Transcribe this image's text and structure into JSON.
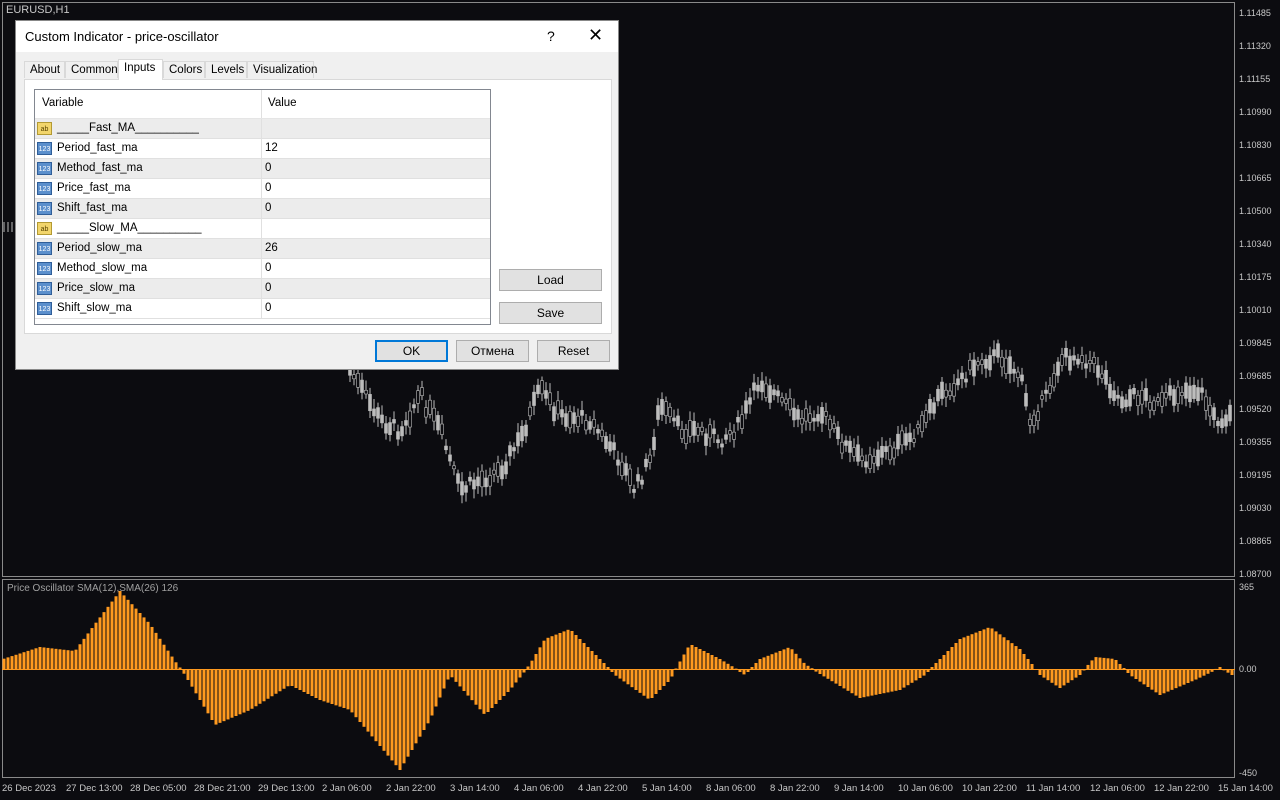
{
  "chart": {
    "symbol_label": "EURUSD,H1",
    "oscillator_label": "Price Oscillator SMA(12),SMA(26) 126",
    "bar_color": "#ff9a1f",
    "candle_color": "#bdbdbd",
    "price_axis": [
      "1.11485",
      "1.11320",
      "1.11155",
      "1.10990",
      "1.10830",
      "1.10665",
      "1.10500",
      "1.10340",
      "1.10175",
      "1.10010",
      "1.09845",
      "1.09685",
      "1.09520",
      "1.09355",
      "1.09195",
      "1.09030",
      "1.08865",
      "1.08700"
    ],
    "osc_axis": {
      "top": "365",
      "zero": "0.00",
      "bottom": "-450"
    },
    "time_axis": [
      "26 Dec 2023",
      "27 Dec 13:00",
      "28 Dec 05:00",
      "28 Dec 21:00",
      "29 Dec 13:00",
      "2 Jan 06:00",
      "2 Jan 22:00",
      "3 Jan 14:00",
      "4 Jan 06:00",
      "4 Jan 22:00",
      "5 Jan 14:00",
      "8 Jan 06:00",
      "8 Jan 22:00",
      "9 Jan 14:00",
      "10 Jan 06:00",
      "10 Jan 22:00",
      "11 Jan 14:00",
      "12 Jan 06:00",
      "12 Jan 22:00",
      "15 Jan 14:00"
    ]
  },
  "dialog": {
    "title": "Custom Indicator - price-oscillator",
    "help_glyph": "?",
    "close_glyph": "✕",
    "tabs": [
      "About",
      "Common",
      "Inputs",
      "Colors",
      "Levels",
      "Visualization"
    ],
    "active_tab": "Inputs",
    "grid": {
      "col_variable": "Variable",
      "col_value": "Value",
      "rows": [
        {
          "icon": "ab",
          "name": "_____Fast_MA__________",
          "value": ""
        },
        {
          "icon": "123",
          "name": "Period_fast_ma",
          "value": "12"
        },
        {
          "icon": "123",
          "name": "Method_fast_ma",
          "value": "0"
        },
        {
          "icon": "123",
          "name": "Price_fast_ma",
          "value": "0"
        },
        {
          "icon": "123",
          "name": "Shift_fast_ma",
          "value": "0"
        },
        {
          "icon": "ab",
          "name": "_____Slow_MA__________",
          "value": ""
        },
        {
          "icon": "123",
          "name": "Period_slow_ma",
          "value": "26"
        },
        {
          "icon": "123",
          "name": "Method_slow_ma",
          "value": "0"
        },
        {
          "icon": "123",
          "name": "Price_slow_ma",
          "value": "0"
        },
        {
          "icon": "123",
          "name": "Shift_slow_ma",
          "value": "0"
        }
      ]
    },
    "load_label": "Load",
    "save_label": "Save",
    "ok_label": "OK",
    "cancel_label": "Отмена",
    "reset_label": "Reset"
  }
}
